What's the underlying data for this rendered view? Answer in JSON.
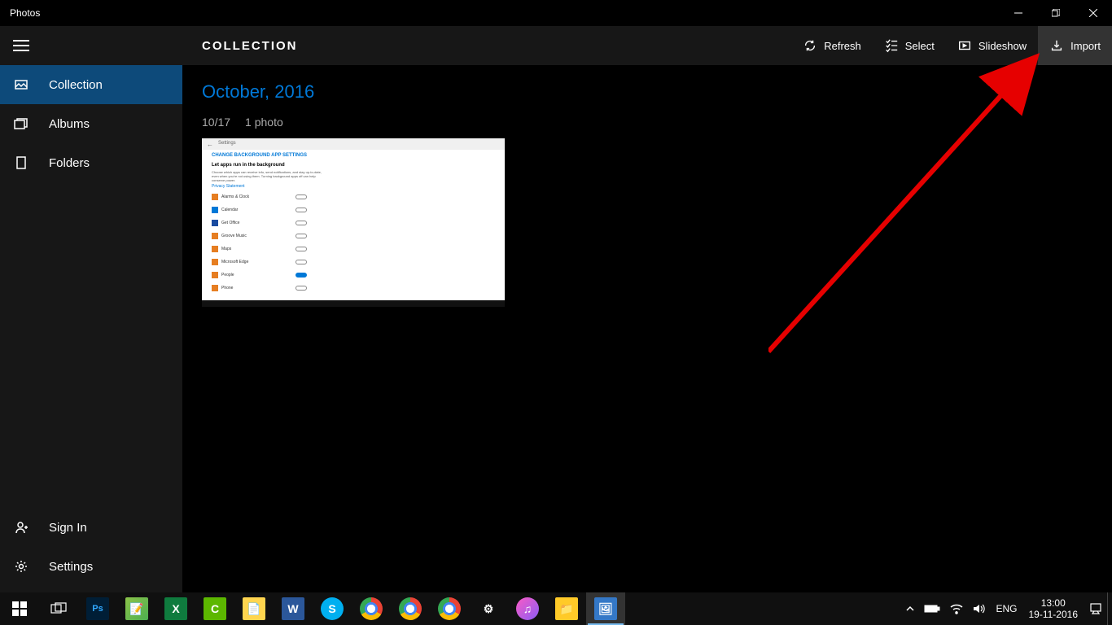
{
  "window": {
    "title": "Photos"
  },
  "sidebar": {
    "items": [
      {
        "label": "Collection"
      },
      {
        "label": "Albums"
      },
      {
        "label": "Folders"
      }
    ],
    "sign_in": "Sign In",
    "settings": "Settings"
  },
  "toolbar": {
    "title": "COLLECTION",
    "refresh": "Refresh",
    "select": "Select",
    "slideshow": "Slideshow",
    "import": "Import"
  },
  "content": {
    "month": "October, 2016",
    "date": "10/17",
    "count": "1 photo",
    "thumb": {
      "header_back": "←",
      "header_label": "Settings",
      "title": "CHANGE BACKGROUND APP SETTINGS",
      "subtitle": "Let apps run in the background",
      "desc": "Choose which apps can receive info, send notifications, and stay up-to-date, even when you're not using them. Turning background apps off can help conserve power.",
      "link": "Privacy Statement",
      "rows": [
        {
          "label": "Alarms & Clock",
          "color": "#e67e22"
        },
        {
          "label": "Calendar",
          "color": "#0078d7"
        },
        {
          "label": "Get Office",
          "color": "#1a4ba0"
        },
        {
          "label": "Groove Music",
          "color": "#e67e22"
        },
        {
          "label": "Maps",
          "color": "#e67e22"
        },
        {
          "label": "Microsoft Edge",
          "color": "#e67e22"
        },
        {
          "label": "People",
          "color": "#e67e22"
        },
        {
          "label": "Phone",
          "color": "#e67e22"
        }
      ]
    }
  },
  "taskbar": {
    "time": "13:00",
    "date": "19-11-2016",
    "lang": "ENG"
  }
}
